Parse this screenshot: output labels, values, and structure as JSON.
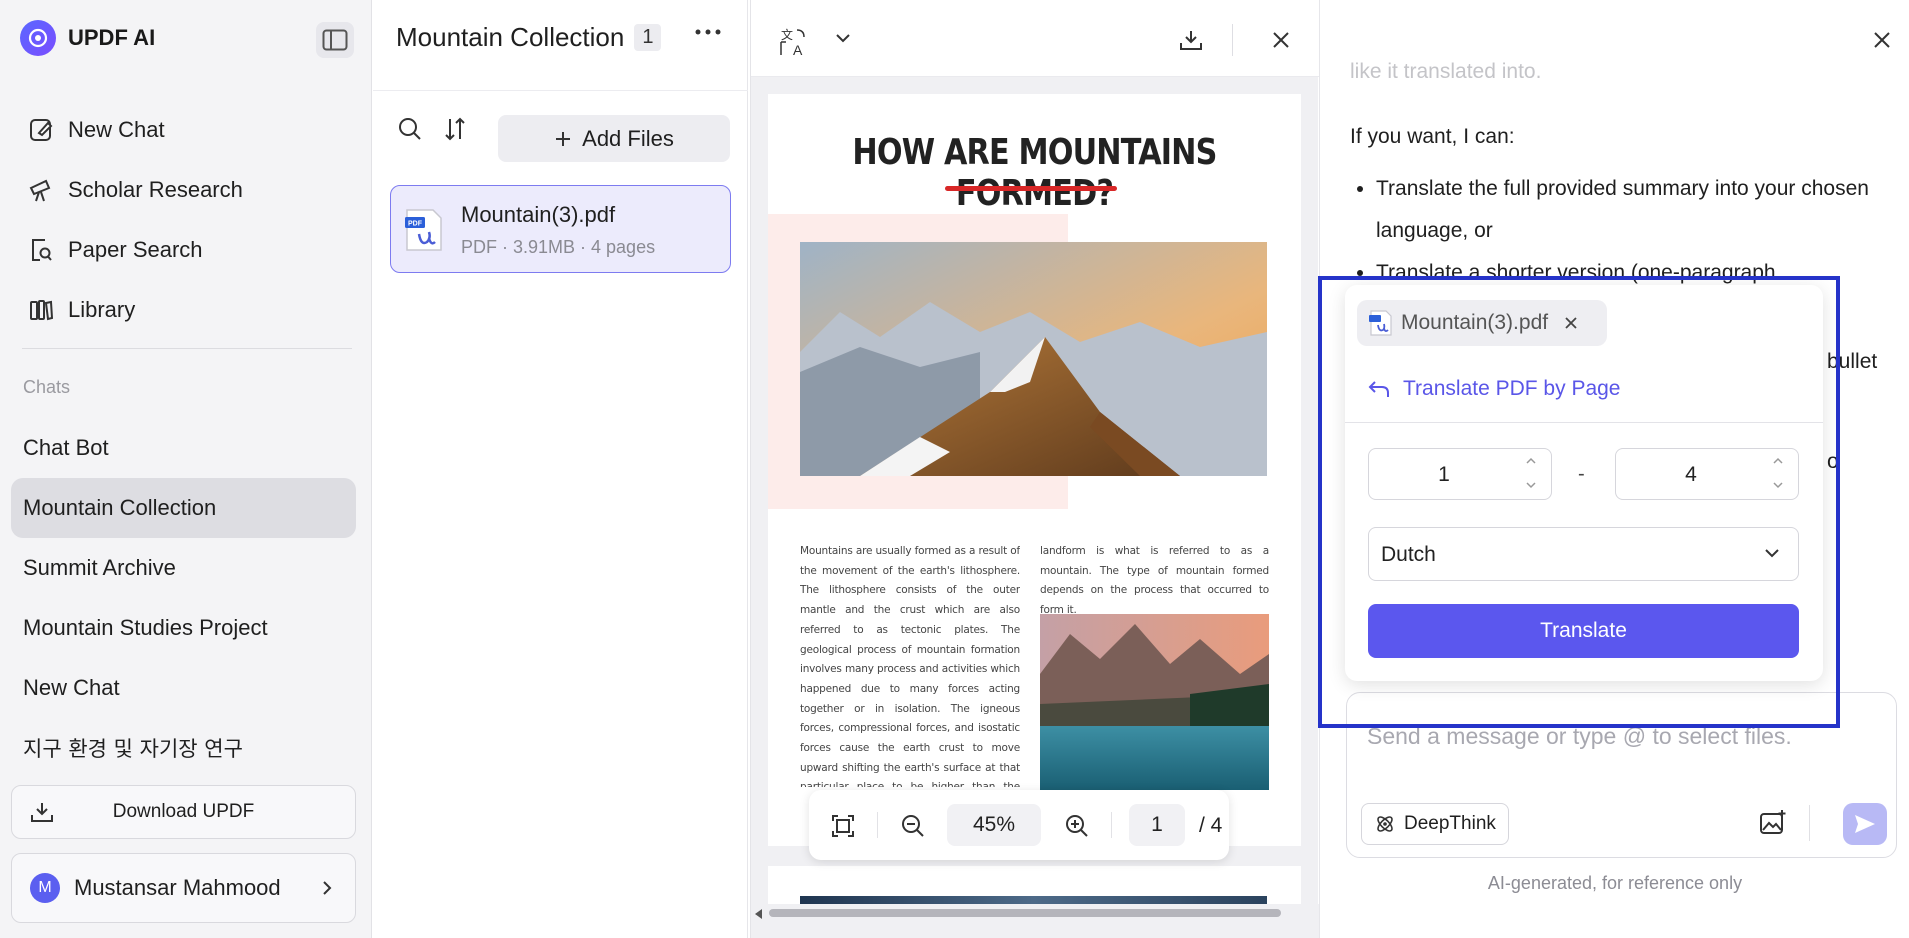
{
  "app": {
    "name": "UPDF AI"
  },
  "sidebar": {
    "nav": [
      {
        "label": "New Chat",
        "icon": "edit-icon"
      },
      {
        "label": "Scholar Research",
        "icon": "telescope-icon"
      },
      {
        "label": "Paper Search",
        "icon": "search-doc-icon"
      },
      {
        "label": "Library",
        "icon": "library-icon"
      }
    ],
    "chats_label": "Chats",
    "chats": [
      {
        "label": "Chat Bot",
        "active": false
      },
      {
        "label": "Mountain Collection",
        "active": true
      },
      {
        "label": "Summit Archive",
        "active": false
      },
      {
        "label": "Mountain Studies Project",
        "active": false
      },
      {
        "label": "New Chat",
        "active": false
      },
      {
        "label": "지구 환경 및 자기장 연구",
        "active": false
      }
    ],
    "download_label": "Download UPDF",
    "user": {
      "initial": "M",
      "name": "Mustansar Mahmood"
    }
  },
  "files_panel": {
    "title": "Mountain Collection",
    "count": "1",
    "add_files_label": "Add Files",
    "file": {
      "name": "Mountain(3).pdf",
      "meta": "PDF · 3.91MB · 4 pages"
    }
  },
  "viewer": {
    "page_title": "HOW ARE MOUNTAINS FORMED?",
    "col1_text": "Mountains are usually formed as a result of the movement of the earth's lithosphere. The lithosphere consists of the outer mantle and the crust which are also referred to as tectonic plates. The geological process of mountain formation involves many process and activities which happened due to many forces acting together or in isolation. The igneous forces, compressional forces, and isostatic forces cause the earth crust to move upward shifting the earth's surface at that particular place to be higher than the surrounding environment. The resultant",
    "col2_text": "landform is what is referred to as a mountain. The type of mountain formed depends on the process that occurred to form it.",
    "zoom": "45%",
    "page": "1",
    "total": "/ 4"
  },
  "chat": {
    "faded_line": "like it translated into.",
    "intro": "If you want, I can:",
    "bullets": [
      "Translate the full provided summary into your chosen language, or",
      "Translate a shorter version (one-paragraph"
    ],
    "peek1": "bullet",
    "peek2": "o",
    "composer_placeholder": "Send a message or type @ to select files.",
    "deepthink_label": "DeepThink",
    "disclaimer": "AI-generated, for reference only"
  },
  "translate_popover": {
    "file_chip": "Mountain(3).pdf",
    "mode_label": "Translate PDF by Page",
    "from_page": "1",
    "separator": "-",
    "to_page": "4",
    "language": "Dutch",
    "button_label": "Translate"
  },
  "colors": {
    "accent": "#5b57ee",
    "highlight_border": "#2533c9",
    "title_underline": "#d82727"
  }
}
